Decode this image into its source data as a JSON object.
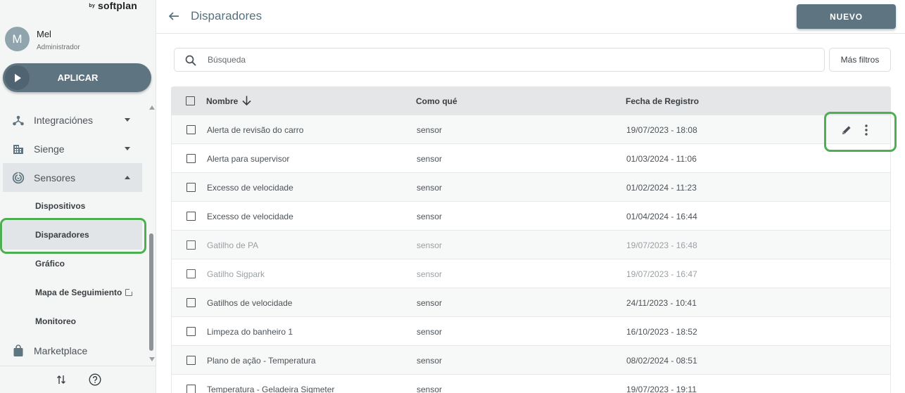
{
  "brand": {
    "prefix": "by",
    "name": "softplan"
  },
  "user": {
    "initial": "M",
    "name": "Mel",
    "role": "Administrador"
  },
  "apply_button": {
    "label": "APLICAR"
  },
  "sidebar": {
    "items": [
      {
        "label": "Integraciónes",
        "icon": "integrations-icon"
      },
      {
        "label": "Sienge",
        "icon": "building-icon"
      },
      {
        "label": "Sensores",
        "icon": "sensor-icon"
      }
    ],
    "sub_items": [
      {
        "label": "Dispositivos"
      },
      {
        "label": "Disparadores"
      },
      {
        "label": "Gráfico"
      },
      {
        "label": "Mapa de Seguimiento"
      },
      {
        "label": "Monitoreo"
      }
    ],
    "bottom_item": {
      "label": "Marketplace",
      "icon": "bag-icon"
    }
  },
  "header": {
    "title": "Disparadores",
    "new_button": "NUEVO"
  },
  "search": {
    "placeholder": "Búsqueda",
    "more_filters": "Más filtros"
  },
  "table": {
    "columns": {
      "name": "Nombre",
      "how": "Como qué",
      "date": "Fecha de Registro"
    },
    "rows": [
      {
        "name": "Alerta de revisão do carro",
        "how": "sensor",
        "date": "19/07/2023 - 18:08"
      },
      {
        "name": "Alerta para supervisor",
        "how": "sensor",
        "date": "01/03/2024 - 11:06"
      },
      {
        "name": "Excesso de velocidade",
        "how": "sensor",
        "date": "01/02/2024 - 11:23"
      },
      {
        "name": "Excesso de velocidade",
        "how": "sensor",
        "date": "01/04/2024 - 16:44"
      },
      {
        "name": "Gatilho de PA",
        "how": "sensor",
        "date": "19/07/2023 - 16:48"
      },
      {
        "name": "Gatilho Sigpark",
        "how": "sensor",
        "date": "19/07/2023 - 16:47"
      },
      {
        "name": "Gatilhos de velocidade",
        "how": "sensor",
        "date": "24/11/2023 - 10:41"
      },
      {
        "name": "Limpeza do banheiro 1",
        "how": "sensor",
        "date": "16/10/2023 - 18:52"
      },
      {
        "name": "Plano de ação - Temperatura",
        "how": "sensor",
        "date": "08/02/2024 - 08:51"
      },
      {
        "name": "Temperatura - Geladeira Sigmeter",
        "how": "sensor",
        "date": "19/07/2023 - 19:11"
      }
    ]
  },
  "colors": {
    "accent": "#5e7581",
    "highlight": "#4caf50",
    "title": "#55707e"
  }
}
